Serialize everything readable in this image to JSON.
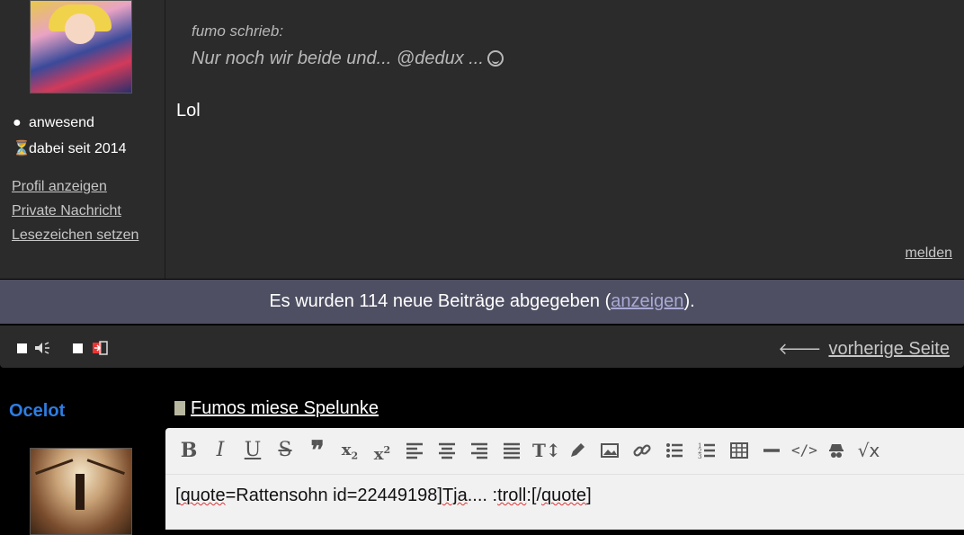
{
  "post": {
    "status": "anwesend",
    "member_since": "dabei seit 2014",
    "links": [
      "Profil anzeigen",
      "Private Nachricht",
      "Lesezeichen setzen"
    ],
    "quote_author": "fumo schrieb:",
    "quote_text": "Nur noch wir beide und... @dedux ...",
    "body": "Lol",
    "report_label": "melden"
  },
  "new_posts_bar": {
    "prefix": "Es wurden 114 neue Beiträge abgegeben (",
    "link": "anzeigen",
    "suffix": ")."
  },
  "nav": {
    "prev_page": "vorherige Seite"
  },
  "reply": {
    "username": "Ocelot",
    "thread_title": "Fumos miese Spelunke",
    "editor_text_parts": [
      "[",
      "quote",
      "=Rattensohn id=22449198]",
      "Tja",
      ".... :",
      "troll",
      ":[/",
      "quote",
      "]"
    ]
  },
  "colors": {
    "username": "#2e7de1",
    "newbar_bg": "#4e4f62",
    "post_bg": "#2b2b2b"
  }
}
